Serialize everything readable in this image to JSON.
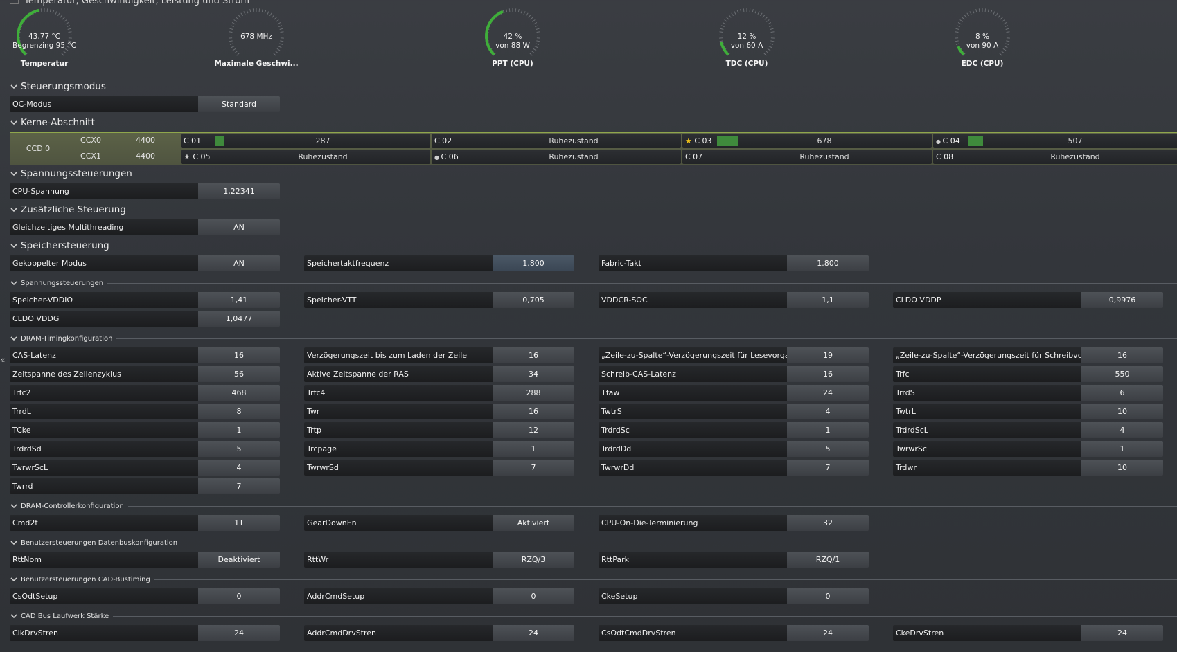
{
  "header": {
    "title": "Temperatur, Geschwindigkeit, Leistung und Strom"
  },
  "gauges": [
    {
      "line1": "43,77 °C",
      "line2": "Begrenzing  95 °C",
      "label": "Temperatur",
      "fraction": 0.46,
      "color": "#3fae3a"
    },
    {
      "line1": "678  MHz",
      "line2": "",
      "label": "Maximale Geschwi...",
      "fraction": 0.0,
      "color": "#3fae3a"
    },
    {
      "line1": "42 %",
      "line2": "von  88 W",
      "label": "PPT (CPU)",
      "fraction": 0.42,
      "color": "#3fae3a"
    },
    {
      "line1": "12 %",
      "line2": "von  60 A",
      "label": "TDC (CPU)",
      "fraction": 0.12,
      "color": "#3fae3a"
    },
    {
      "line1": "8 %",
      "line2": "von  90 A",
      "label": "EDC (CPU)",
      "fraction": 0.08,
      "color": "#3fae3a"
    }
  ],
  "sections": {
    "steuerungsmodus": "Steuerungsmodus",
    "kerne": "Kerne-Abschnitt",
    "spannung": "Spannungssteuerungen",
    "zusaetzlich": "Zusätzliche Steuerung",
    "speicher": "Speichersteuerung",
    "spannung2": "Spannungssteuerungen",
    "dram_timing": "DRAM-Timingkonfiguration",
    "dram_ctrl": "DRAM-Controllerkonfiguration",
    "datenbus": "Benutzersteuerungen Datenbuskonfiguration",
    "cad": "Benutzersteuerungen CAD-Bustiming",
    "cad_drive": "CAD Bus Laufwerk Stärke"
  },
  "oc": [
    {
      "k": "OC-Modus",
      "v": "Standard"
    }
  ],
  "kerne": {
    "ccd": "CCD 0",
    "ccx": [
      {
        "name": "CCX0",
        "freq": "4400"
      },
      {
        "name": "CCX1",
        "freq": "4400"
      }
    ],
    "cores": [
      {
        "name": "C 01",
        "value": "287",
        "load": 0.04,
        "mark": ""
      },
      {
        "name": "C 02",
        "value": "Ruhezustand",
        "load": 0,
        "mark": ""
      },
      {
        "name": "C 03",
        "value": "678",
        "load": 0.1,
        "mark": "star-gold"
      },
      {
        "name": "C 04",
        "value": "507",
        "load": 0.07,
        "mark": "dot"
      },
      {
        "name": "C 05",
        "value": "Ruhezustand",
        "load": 0,
        "mark": "star-grey"
      },
      {
        "name": "C 06",
        "value": "Ruhezustand",
        "load": 0,
        "mark": "dot"
      },
      {
        "name": "C 07",
        "value": "Ruhezustand",
        "load": 0,
        "mark": ""
      },
      {
        "name": "C 08",
        "value": "Ruhezustand",
        "load": 0,
        "mark": ""
      }
    ]
  },
  "cpu_voltage": [
    {
      "k": "CPU-Spannung",
      "v": "1,22341"
    }
  ],
  "additional": [
    {
      "k": "Gleichzeitiges Multithreading",
      "v": "AN"
    }
  ],
  "memory": [
    {
      "k": "Gekoppelter Modus",
      "v": "AN"
    },
    {
      "k": "Speichertaktfrequenz",
      "v": "1.800"
    },
    {
      "k": "Fabric-Takt",
      "v": "1.800"
    }
  ],
  "voltages": [
    {
      "k": "Speicher-VDDIO",
      "v": "1,41"
    },
    {
      "k": "Speicher-VTT",
      "v": "0,705"
    },
    {
      "k": "VDDCR-SOC",
      "v": "1,1"
    },
    {
      "k": "CLDO VDDP",
      "v": "0,9976"
    },
    {
      "k": "CLDO VDDG",
      "v": "1,0477"
    }
  ],
  "timings": [
    {
      "k": "CAS-Latenz",
      "v": "16"
    },
    {
      "k": "Verzögerungszeit bis zum Laden der Zeile",
      "v": "16"
    },
    {
      "k": "„Zeile-zu-Spalte“-Verzögerungszeit für Lesevorgang",
      "v": "19"
    },
    {
      "k": "„Zeile-zu-Spalte“-Verzögerungszeit für Schreibvorgang",
      "v": "16"
    },
    {
      "k": "Zeitspanne des Zeilenzyklus",
      "v": "56"
    },
    {
      "k": "Aktive Zeitspanne der RAS",
      "v": "34"
    },
    {
      "k": "Schreib-CAS-Latenz",
      "v": "16"
    },
    {
      "k": "Trfc",
      "v": "550"
    },
    {
      "k": "Trfc2",
      "v": "468"
    },
    {
      "k": "Trfc4",
      "v": "288"
    },
    {
      "k": "Tfaw",
      "v": "24"
    },
    {
      "k": "TrrdS",
      "v": "6"
    },
    {
      "k": "TrrdL",
      "v": "8"
    },
    {
      "k": "Twr",
      "v": "16"
    },
    {
      "k": "TwtrS",
      "v": "4"
    },
    {
      "k": "TwtrL",
      "v": "10"
    },
    {
      "k": "TCke",
      "v": "1"
    },
    {
      "k": "Trtp",
      "v": "12"
    },
    {
      "k": "TrdrdSc",
      "v": "1"
    },
    {
      "k": "TrdrdScL",
      "v": "4"
    },
    {
      "k": "TrdrdSd",
      "v": "5"
    },
    {
      "k": "Trcpage",
      "v": "1"
    },
    {
      "k": "TrdrdDd",
      "v": "5"
    },
    {
      "k": "TwrwrSc",
      "v": "1"
    },
    {
      "k": "TwrwrScL",
      "v": "4"
    },
    {
      "k": "TwrwrSd",
      "v": "7"
    },
    {
      "k": "TwrwrDd",
      "v": "7"
    },
    {
      "k": "Trdwr",
      "v": "10"
    },
    {
      "k": "Twrrd",
      "v": "7"
    }
  ],
  "controller": [
    {
      "k": "Cmd2t",
      "v": "1T"
    },
    {
      "k": "GearDownEn",
      "v": "Aktiviert"
    },
    {
      "k": "CPU-On-Die-Terminierung",
      "v": "32"
    }
  ],
  "databus": [
    {
      "k": "RttNom",
      "v": "Deaktiviert"
    },
    {
      "k": "RttWr",
      "v": "RZQ/3"
    },
    {
      "k": "RttPark",
      "v": "RZQ/1"
    }
  ],
  "cad_timing": [
    {
      "k": "CsOdtSetup",
      "v": "0"
    },
    {
      "k": "AddrCmdSetup",
      "v": "0"
    },
    {
      "k": "CkeSetup",
      "v": "0"
    }
  ],
  "cad_drive": [
    {
      "k": "ClkDrvStren",
      "v": "24"
    },
    {
      "k": "AddrCmdDrvStren",
      "v": "24"
    },
    {
      "k": "CsOdtCmdDrvStren",
      "v": "24"
    },
    {
      "k": "CkeDrvStren",
      "v": "24"
    }
  ],
  "side": {
    "arrow": "«"
  }
}
